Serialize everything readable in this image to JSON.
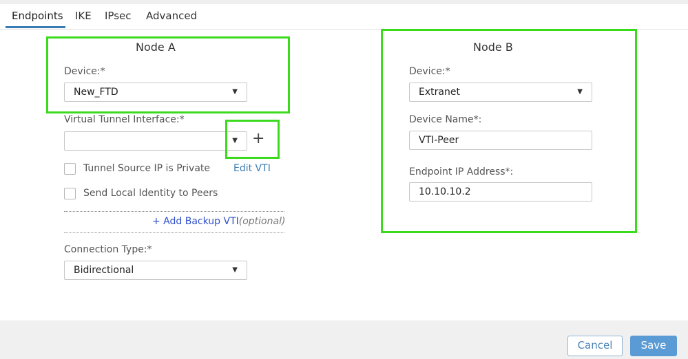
{
  "tabs": [
    {
      "label": "Endpoints",
      "active": true
    },
    {
      "label": "IKE",
      "active": false
    },
    {
      "label": "IPsec",
      "active": false
    },
    {
      "label": "Advanced",
      "active": false
    }
  ],
  "node_a": {
    "title": "Node A",
    "device_label": "Device:*",
    "device_value": "New_FTD",
    "vti_label": "Virtual Tunnel Interface:*",
    "vti_value": "",
    "tunnel_source_label": "Tunnel Source IP is Private",
    "tunnel_source_checked": false,
    "edit_vti_label": "Edit VTI",
    "send_identity_label": "Send Local Identity to Peers",
    "send_identity_checked": false,
    "add_backup_label": "+ Add Backup VTI",
    "add_backup_optional": "(optional)",
    "connection_type_label": "Connection Type:*",
    "connection_type_value": "Bidirectional"
  },
  "node_b": {
    "title": "Node B",
    "device_label": "Device:*",
    "device_value": "Extranet",
    "device_name_label": "Device Name*:",
    "device_name_value": "VTI-Peer",
    "endpoint_ip_label": "Endpoint IP Address*:",
    "endpoint_ip_value": "10.10.10.2"
  },
  "footer": {
    "cancel_label": "Cancel",
    "save_label": "Save"
  },
  "icons": {
    "caret": "▼",
    "plus": "+"
  },
  "colors": {
    "accent": "#3b7cb3",
    "highlight": "#3adb1c",
    "save_button": "#5b9bd5"
  }
}
